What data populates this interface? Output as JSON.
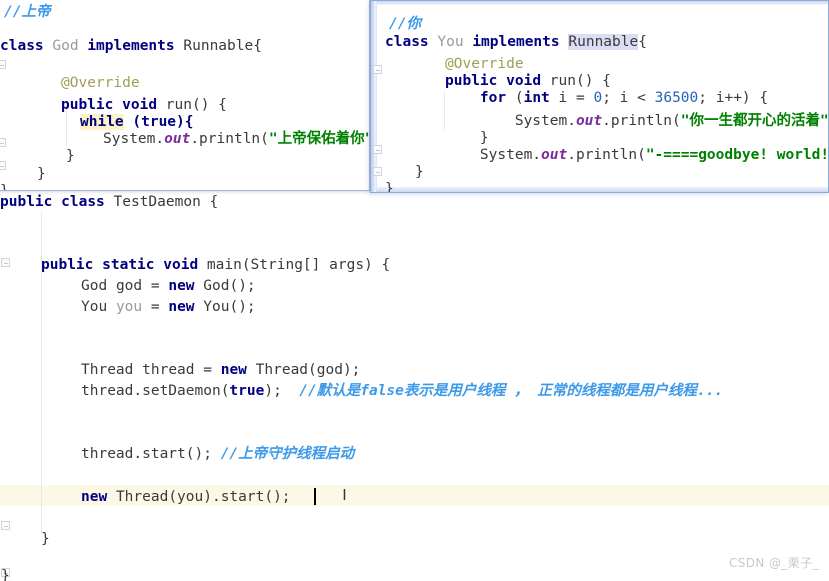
{
  "app": {
    "kind": "java-code-editor",
    "watermark": "CSDN @_栗子_"
  },
  "editor": {
    "filename_class": "TestDaemon",
    "current_line_highlight_color": "#fdf7e5",
    "lines": [
      {
        "id": "l-class-decl",
        "text": "public class TestDaemon {"
      },
      {
        "id": "l-main-decl",
        "text": "public static void main(String[] args) {"
      },
      {
        "id": "l-god-new",
        "text": "God god = new God();"
      },
      {
        "id": "l-you-new",
        "text": "You you = new You();"
      },
      {
        "id": "l-thread-new",
        "text": "Thread thread = new Thread(god);"
      },
      {
        "id": "l-setdaemon",
        "text": "thread.setDaemon(true);"
      },
      {
        "id": "l-setdaemon-c",
        "text": "//默认是false表示是用户线程 ， 正常的线程都是用户线程..."
      },
      {
        "id": "l-start",
        "text": "thread.start();"
      },
      {
        "id": "l-start-c",
        "text": "//上帝守护线程启动"
      },
      {
        "id": "l-new-thread",
        "text": "new Thread(you).start();"
      },
      {
        "id": "l-close-main",
        "text": "}"
      },
      {
        "id": "l-close-class",
        "text": "}"
      }
    ],
    "tokens": {
      "kw_public": "public",
      "kw_class": "class",
      "kw_static": "static",
      "kw_void": "void",
      "kw_new": "new",
      "kw_true": "true",
      "type_TestDaemon": "TestDaemon",
      "id_main": "main",
      "type_String_args": "(String[] args) {",
      "type_God": "God",
      "var_god": "god",
      "type_You": "You",
      "var_you": "you",
      "type_Thread": "Thread",
      "var_thread": "thread",
      "call_setDaemon": ".setDaemon(",
      "call_start": ".start();",
      "ctor_God": "God();",
      "ctor_You": "You();",
      "ctor_Thread_god": "Thread(god);",
      "ctor_Thread_you": "Thread(you).start();",
      "eq": "=",
      "semi": ");",
      "brace_close": "}"
    }
  },
  "popup_left": {
    "title_hint": "God class definition preview",
    "lines": [
      {
        "id": "pl-comment",
        "text": "//上帝"
      },
      {
        "id": "pl-class",
        "text": "class God implements Runnable{"
      },
      {
        "id": "pl-override",
        "text": "@Override"
      },
      {
        "id": "pl-run",
        "text": "public void run() {"
      },
      {
        "id": "pl-while",
        "text": "while (true){"
      },
      {
        "id": "pl-println",
        "text": "System.out.println(\"上帝保佑着你\");"
      },
      {
        "id": "pl-close1",
        "text": "}"
      },
      {
        "id": "pl-close2",
        "text": "}"
      },
      {
        "id": "pl-close3",
        "text": "}"
      }
    ],
    "tokens": {
      "comment": "//上帝",
      "kw_class": "class",
      "name_God": "God",
      "kw_implements": "implements",
      "iface_Runnable": "Runnable{",
      "annotation": "@Override",
      "kw_public": "public",
      "kw_void": "void",
      "id_run": "run() {",
      "kw_while": "while",
      "cond_true": "(true){",
      "sys": "System.",
      "out": "out",
      "println": ".println(",
      "string": "\"上帝保佑着你\"",
      "tail": ");"
    }
  },
  "popup_right": {
    "title_hint": "You class definition preview",
    "lines": [
      {
        "id": "pr-comment",
        "text": "//你"
      },
      {
        "id": "pr-class",
        "text": "class You implements Runnable{"
      },
      {
        "id": "pr-override",
        "text": "@Override"
      },
      {
        "id": "pr-run",
        "text": "public void run() {"
      },
      {
        "id": "pr-for",
        "text": "for (int i = 0; i < 36500; i++) {"
      },
      {
        "id": "pr-println1",
        "text": "System.out.println(\"你一生都开心的活着\");"
      },
      {
        "id": "pr-close1",
        "text": "}"
      },
      {
        "id": "pr-println2",
        "text": "System.out.println(\"-====goodbye! world!=======\");"
      },
      {
        "id": "pr-close2",
        "text": "}"
      },
      {
        "id": "pr-close3",
        "text": "}"
      }
    ],
    "tokens": {
      "comment": "//你",
      "kw_class": "class",
      "name_You": "You",
      "kw_implements": "implements",
      "iface_Runnable": "Runnable",
      "brace_open": "{",
      "annotation": "@Override",
      "kw_public": "public",
      "kw_void": "void",
      "id_run": "run() {",
      "kw_for": "for",
      "kw_int": "int",
      "var_i": "i",
      "num_zero": "0",
      "num_limit": "36500",
      "for_tail": "i++) {",
      "sys": "System.",
      "out": "out",
      "println": ".println(",
      "string1": "\"你一生都开心的活着\"",
      "string2": "\"-====goodbye! world!=======\"",
      "tail": ");"
    }
  },
  "colors": {
    "keyword": "#000080",
    "string": "#008000",
    "comment": "#3d9ae8",
    "number": "#2a63b8",
    "annotation": "#9e9e54",
    "field": "#7a2a9e",
    "dim_identifier": "#9a9a9a",
    "current_line": "#fdf7e5",
    "highlight_yellow": "#fbf2c8",
    "highlight_lavender": "#dcdcf5",
    "popup_border": "#8fa8dd"
  }
}
